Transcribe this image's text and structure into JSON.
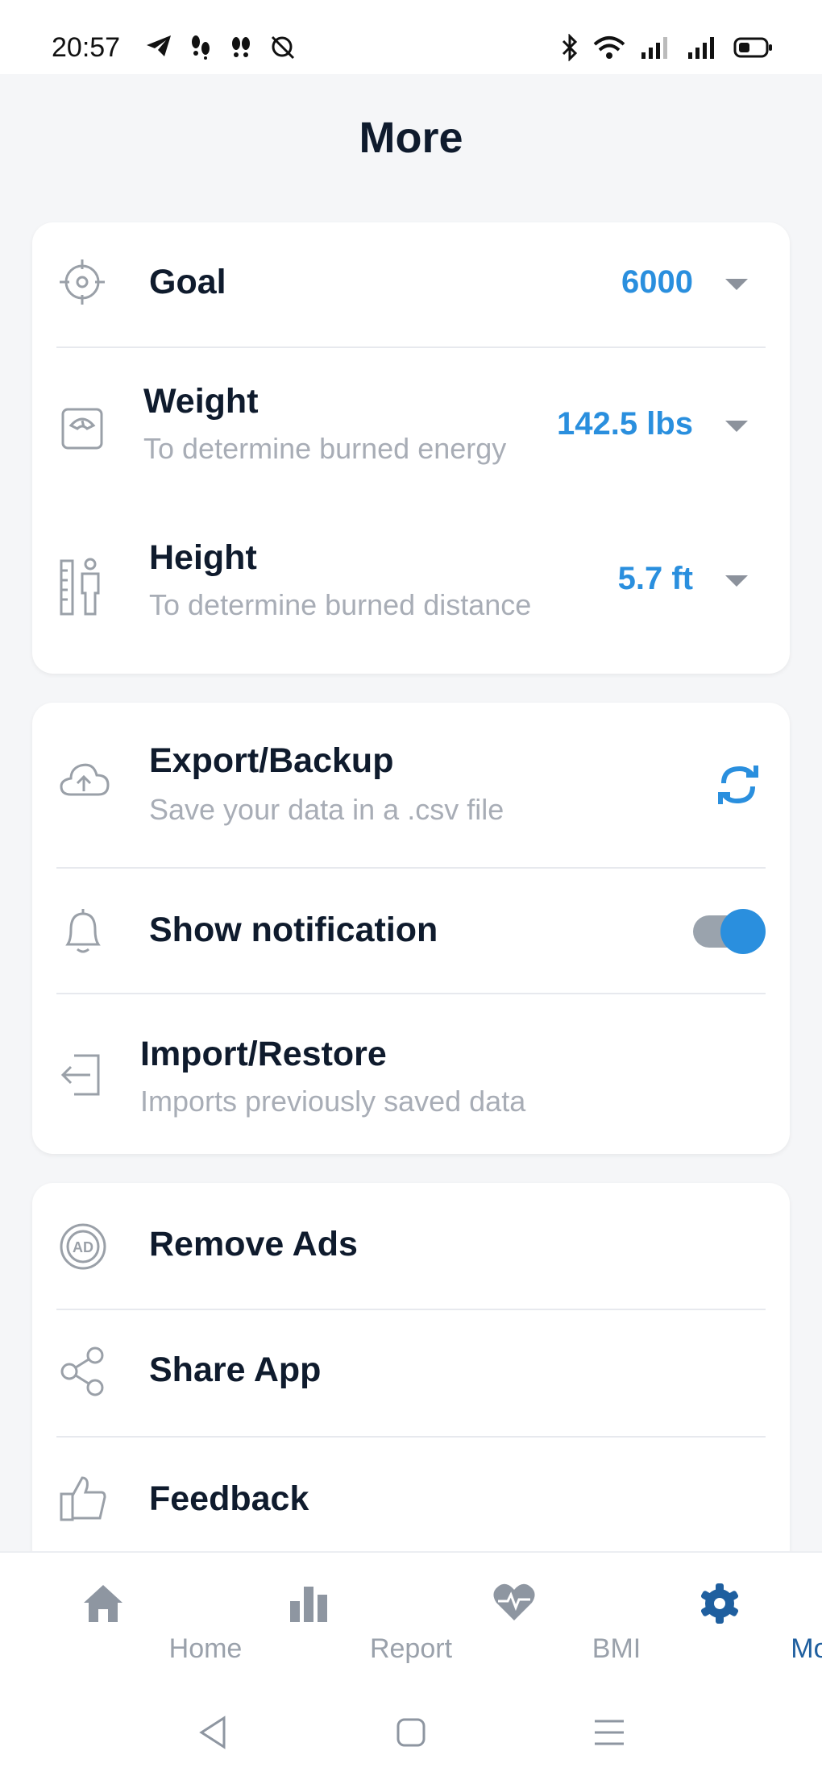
{
  "status_bar": {
    "time": "20:57",
    "left_icons": [
      "telegram-icon",
      "footsteps-icon",
      "footsteps-icon",
      "no-alarm-icon"
    ],
    "right_icons": [
      "bluetooth-icon",
      "wifi-icon",
      "signal-icon",
      "signal-icon",
      "battery-icon"
    ]
  },
  "page_title": "More",
  "settings_card": {
    "goal": {
      "title": "Goal",
      "value": "6000",
      "icon": "target-icon"
    },
    "weight": {
      "title": "Weight",
      "subtitle": "To determine burned energy",
      "value": "142.5 lbs",
      "icon": "scale-icon"
    },
    "height": {
      "title": "Height",
      "subtitle": "To determine burned distance",
      "value": "5.7 ft",
      "icon": "height-icon"
    }
  },
  "data_card": {
    "export": {
      "title": "Export/Backup",
      "subtitle": "Save your data in a .csv file",
      "icon": "cloud-upload-icon"
    },
    "notification": {
      "title": "Show notification",
      "enabled": true,
      "icon": "bell-icon"
    },
    "import": {
      "title": "Import/Restore",
      "subtitle": "Imports previously saved data",
      "icon": "import-icon"
    }
  },
  "misc_card": {
    "remove_ads": {
      "title": "Remove Ads",
      "icon": "no-ads-icon"
    },
    "share": {
      "title": "Share App",
      "icon": "share-icon"
    },
    "feedback": {
      "title": "Feedback",
      "icon": "thumbs-up-icon"
    }
  },
  "bottom_nav": {
    "items": [
      {
        "label": "Home",
        "icon": "home-icon"
      },
      {
        "label": "Report",
        "icon": "bar-chart-icon"
      },
      {
        "label": "BMI",
        "icon": "heart-pulse-icon"
      },
      {
        "label": "More",
        "icon": "gear-icon",
        "active": true
      }
    ]
  },
  "colors": {
    "accent": "#2a8fde",
    "text": "#0f1b2d",
    "muted": "#a8adb6",
    "nav_active": "#1f5f9f"
  }
}
